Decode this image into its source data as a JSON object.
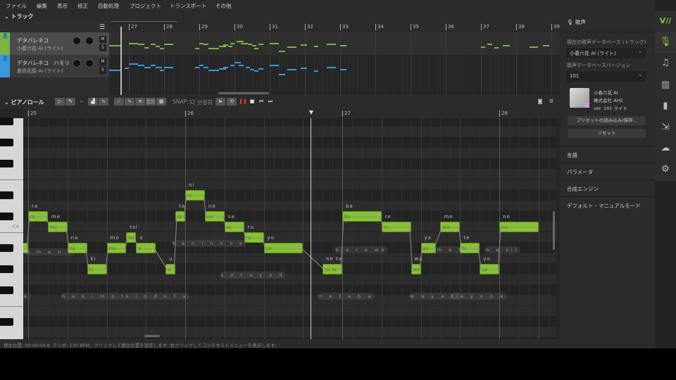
{
  "menu": [
    "ファイル",
    "編集",
    "表示",
    "修正",
    "自動処理",
    "プロジェクト",
    "トランスポート",
    "その他"
  ],
  "track_section": {
    "title": "トラック",
    "bar_numbers": [
      "27",
      "28",
      "29",
      "30",
      "31",
      "32",
      "33",
      "34",
      "35",
      "36",
      "37",
      "38",
      "39"
    ],
    "tracks": [
      {
        "name": "デタバレネコ",
        "voice": "小春六花 AI (ライト)",
        "color": "#7cb342",
        "mute": "M",
        "solo": "S",
        "selected": true,
        "notes": [
          [
            -9,
            5,
            8
          ],
          [
            0,
            4,
            11
          ],
          [
            4,
            3,
            10
          ],
          [
            7,
            2,
            5
          ],
          [
            10,
            2,
            10
          ],
          [
            12,
            2,
            7
          ],
          [
            14,
            2,
            4
          ],
          [
            16,
            4,
            10
          ],
          [
            30,
            2,
            4
          ],
          [
            32,
            2,
            11
          ],
          [
            34,
            2,
            10
          ],
          [
            36,
            5,
            4
          ],
          [
            41,
            3,
            7
          ],
          [
            43,
            2,
            9
          ],
          [
            45,
            2,
            7
          ],
          [
            46,
            2,
            11
          ],
          [
            49,
            3,
            14
          ],
          [
            51,
            3,
            11
          ],
          [
            54,
            2,
            10
          ],
          [
            56,
            2,
            8
          ],
          [
            57,
            2,
            4
          ],
          [
            59,
            2,
            10
          ],
          [
            64,
            4,
            11
          ],
          [
            68,
            3,
            0
          ],
          [
            72,
            4,
            6
          ],
          [
            78,
            3,
            9
          ],
          [
            84,
            2,
            7
          ],
          [
            90,
            4,
            10
          ],
          [
            96,
            3,
            8
          ],
          [
            160,
            2,
            6
          ],
          [
            163,
            2,
            10
          ],
          [
            166,
            2,
            5
          ],
          [
            170,
            3,
            8
          ],
          [
            182,
            4,
            6
          ],
          [
            188,
            3,
            8
          ]
        ]
      },
      {
        "name": "デタバレネコ　ハモリ",
        "voice": "夏色花梨 AI (ライト)",
        "color": "#3a9ad9",
        "mute": "M",
        "solo": "S",
        "selected": false,
        "notes": [
          [
            -9,
            5,
            5
          ],
          [
            -2,
            2,
            8
          ],
          [
            0,
            4,
            14
          ],
          [
            4,
            3,
            12
          ],
          [
            7,
            3,
            9
          ],
          [
            10,
            2,
            12
          ],
          [
            12,
            3,
            9
          ],
          [
            14,
            2,
            5
          ],
          [
            16,
            4,
            9
          ],
          [
            30,
            2,
            9
          ],
          [
            32,
            2,
            12
          ],
          [
            34,
            2,
            9
          ],
          [
            36,
            5,
            5
          ],
          [
            41,
            3,
            7
          ],
          [
            43,
            2,
            9
          ],
          [
            46,
            2,
            12
          ],
          [
            48,
            3,
            16
          ],
          [
            50,
            2,
            12
          ],
          [
            53,
            2,
            9
          ],
          [
            55,
            2,
            6
          ],
          [
            57,
            2,
            4
          ],
          [
            59,
            2,
            7
          ],
          [
            64,
            4,
            12
          ],
          [
            68,
            3,
            -1
          ],
          [
            72,
            4,
            6
          ],
          [
            78,
            3,
            8
          ],
          [
            84,
            2,
            4
          ],
          [
            90,
            4,
            9
          ],
          [
            96,
            3,
            6
          ]
        ]
      }
    ]
  },
  "piano_roll": {
    "title": "ピアノロール",
    "snap_label": "SNAP:",
    "snap_value": "32 分音符",
    "bar_numbers": [
      "25",
      "26",
      "27",
      "28"
    ],
    "c4_label": "C4",
    "notes": [
      {
        "lyric": "a",
        "pitch": 58,
        "start": -1,
        "len": 1,
        "show_label": false
      },
      {
        "lyric": "ra",
        "pitch": 61,
        "start": 0,
        "len": 2
      },
      {
        "lyric": "me",
        "pitch": 60,
        "start": 2,
        "len": 2
      },
      {
        "lyric": "na",
        "pitch": 58,
        "start": 4,
        "len": 2
      },
      {
        "lyric": "ki",
        "pitch": 56,
        "start": 6,
        "len": 2
      },
      {
        "lyric": "mo",
        "pitch": 58,
        "start": 8,
        "len": 2
      },
      {
        "lyric": "tsi",
        "pitch": 59,
        "start": 10,
        "len": 1
      },
      {
        "lyric": "o",
        "pitch": 58,
        "start": 11,
        "len": 2
      },
      {
        "lyric": "u",
        "pitch": 56,
        "start": 14,
        "len": 1
      },
      {
        "lyric": "ta",
        "pitch": 61,
        "start": 15,
        "len": 1
      },
      {
        "lyric": "ni",
        "pitch": 63,
        "start": 16,
        "len": 2
      },
      {
        "lyric": "no",
        "pitch": 61,
        "start": 18,
        "len": 2
      },
      {
        "lyric": "se",
        "pitch": 60,
        "start": 20,
        "len": 2
      },
      {
        "lyric": "ru",
        "pitch": 59,
        "start": 22,
        "len": 2
      },
      {
        "lyric": "yo",
        "pitch": 58,
        "start": 24,
        "len": 4
      },
      {
        "lyric": "ne ta",
        "pitch": 56,
        "start": 30,
        "len": 2
      },
      {
        "lyric": "ba",
        "pitch": 61,
        "start": 32,
        "len": 4
      },
      {
        "lyric": "re",
        "pitch": 60,
        "start": 36,
        "len": 3
      },
      {
        "lyric": "wa",
        "pitch": 56,
        "start": 39,
        "len": 1
      },
      {
        "lyric": "ya",
        "pitch": 58,
        "start": 40,
        "len": 1.5
      },
      {
        "lyric": "me",
        "pitch": 60,
        "start": 42,
        "len": 2
      },
      {
        "lyric": "te",
        "pitch": 58,
        "start": 44,
        "len": 2
      },
      {
        "lyric": "yo",
        "pitch": 56,
        "start": 46,
        "len": 2
      },
      {
        "lyric": "ne",
        "pitch": 60,
        "start": 48,
        "len": 4
      }
    ],
    "phonemes": [
      {
        "text": "a m e n a",
        "pitch": 57.5,
        "start": -0.3
      },
      {
        "text": "t a n i n o s e",
        "pitch": 58.3,
        "start": 14.6
      },
      {
        "text": "s e r u y o d",
        "pitch": 55.3,
        "start": 19.5
      },
      {
        "text": "a",
        "pitch": 53.3,
        "start": -0.6
      },
      {
        "text": "n a k i m o ts i o d u t a",
        "pitch": 53.3,
        "start": 3.3
      },
      {
        "text": "b a r e wa",
        "pitch": 57.7,
        "start": 31.2
      },
      {
        "text": "u m e t e",
        "pitch": 57.7,
        "start": 40.5
      },
      {
        "text": "n e sil",
        "pitch": 57.7,
        "start": 46.5
      },
      {
        "text": "n e t a b a",
        "pitch": 53.3,
        "start": 29.5
      },
      {
        "text": "w a y a cl",
        "pitch": 53.3,
        "start": 38.8
      },
      {
        "text": "t e y o n e",
        "pitch": 53.3,
        "start": 43
      }
    ]
  },
  "status": "再生位置: 00:00:04.8, テンポ: 130 BPM。クリックして再生位置を設定します; 右クリックしてコンテキストメニューを表示します。",
  "right_panel": {
    "title": "歌声",
    "db_label": "現在の歌声データベース (トラック)",
    "db_value": "小春六花 AI (ライト)",
    "version_label": "歌声データベースバージョン",
    "version_value": "101",
    "voice_name": "小春六花 AI",
    "company": "株式会社 AHS",
    "version_text": "ver. 101 ライト",
    "preset_button": "プリセットの読み込み/保存...",
    "reset_button": "リセット",
    "sections": [
      "言語",
      "パラメータ",
      "合成エンジン",
      "デフォルト - マニュアルモード"
    ]
  },
  "colors": {
    "accent": "#86c232",
    "blue": "#3a9ad9"
  }
}
